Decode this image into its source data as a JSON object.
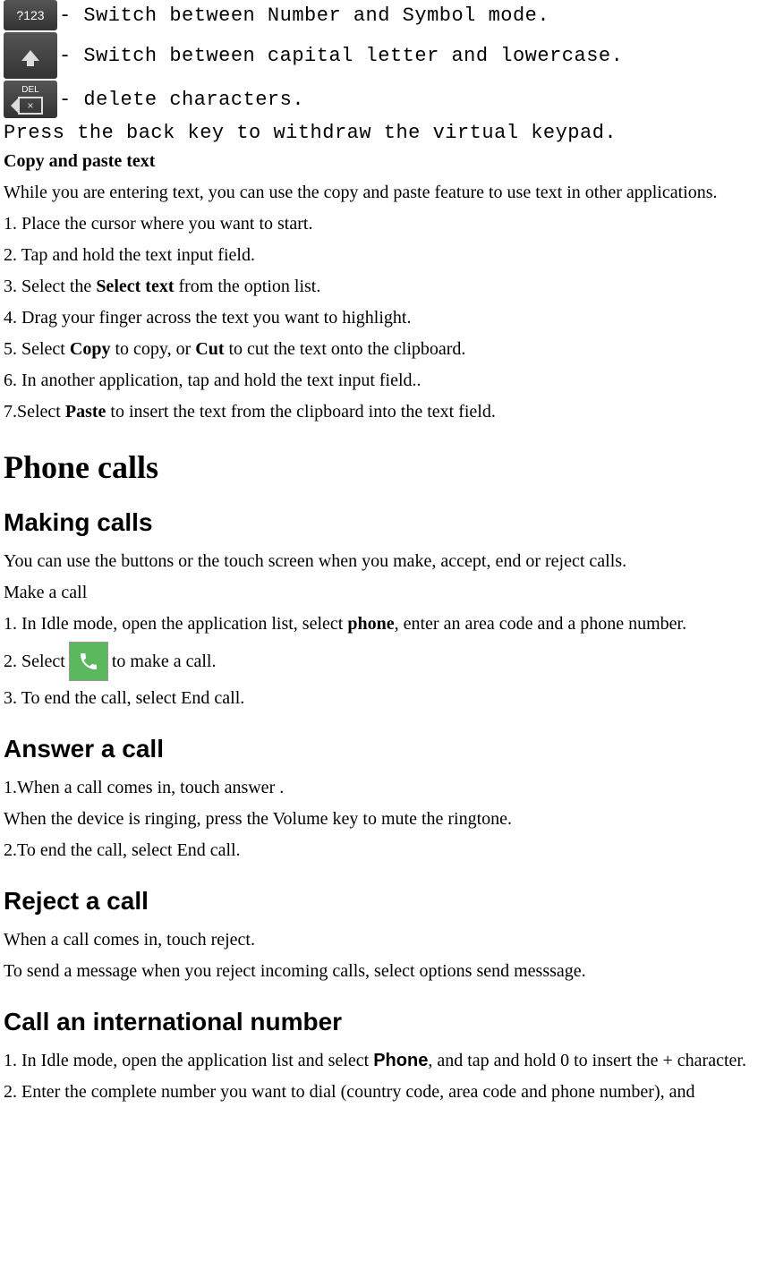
{
  "keyrows": {
    "numsym": {
      "icon_label": "?123",
      "desc": "- Switch between Number and Symbol mode."
    },
    "shift": {
      "desc": "- Switch between capital letter and lowercase."
    },
    "del": {
      "icon_label": "DEL",
      "desc": "- delete characters."
    }
  },
  "withdraw": "Press the back key to withdraw the virtual keypad.",
  "copypaste": {
    "heading": "Copy and paste text",
    "intro": "While you are entering text, you can use the copy and paste feature to use text in other applications.",
    "steps": {
      "s1": "1. Place the cursor where you want to start.",
      "s2": "2. Tap and hold the text input field.",
      "s3_pre": "3. Select the ",
      "s3_bold": "Select text",
      "s3_post": " from the option list.",
      "s4": "4. Drag your finger across the text you want to highlight.",
      "s5_pre": "5. Select ",
      "s5_bold1": "Copy",
      "s5_mid": " to copy, or ",
      "s5_bold2": "Cut",
      "s5_post": " to cut the text onto the clipboard.",
      "s6": "6. In another application, tap and hold the text input field..",
      "s7_pre": "7.Select ",
      "s7_bold": "Paste",
      "s7_post": " to insert the text from the clipboard into the text field."
    }
  },
  "phonecalls": {
    "title": "Phone calls"
  },
  "making": {
    "title": "Making calls",
    "intro": "You can use the buttons or the touch screen when you make, accept, end or reject calls.",
    "makecall": "Make a call",
    "s1_pre": "1. In Idle mode, open the application list, select ",
    "s1_bold": "phone",
    "s1_post": ", enter an area code and a phone number.",
    "s2_pre": "2. Select ",
    "s2_post": " to make a call.",
    "s3": "3. To end the call, select End call."
  },
  "answer": {
    "title": "Answer a call",
    "s1": "1.When a call comes in, touch answer .",
    "s2": "When the device is ringing, press the Volume key to mute the ringtone.",
    "s3": "2.To end the call, select End call."
  },
  "reject": {
    "title": "Reject a call",
    "s1": "When a call comes in, touch reject.",
    "s2": "To send a message when you reject incoming calls, select options send messsage."
  },
  "intl": {
    "title": "Call an international number",
    "s1_pre": "1. In Idle mode, open the application list and select ",
    "s1_bold": "Phone",
    "s1_post": ", and tap and hold 0 to insert the + character.",
    "s2": "2. Enter the complete number you want to dial (country code, area code and phone number), and"
  }
}
